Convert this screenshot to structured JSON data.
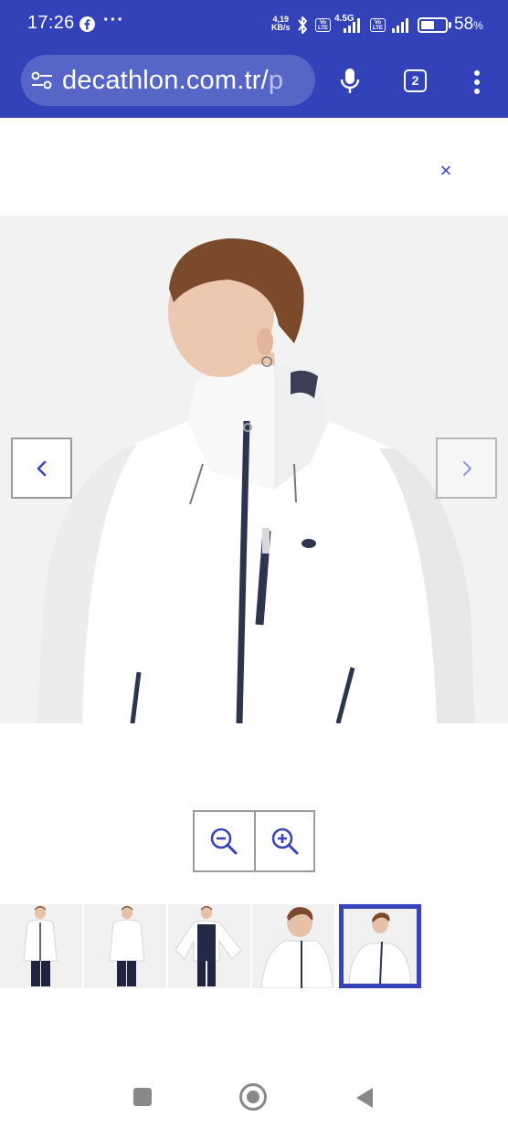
{
  "status_bar": {
    "time": "17:26",
    "notification_dots": "···",
    "net_speed_value": "4,19",
    "net_speed_unit": "KB/s",
    "volte_label": "Vo LTE",
    "network_type": "4.5G",
    "battery_percent": "58",
    "battery_unit": "%",
    "battery_level": 0.58
  },
  "browser": {
    "url_main": "decathlon.com.tr/",
    "url_trail": "p",
    "tab_count": "2"
  },
  "page": {
    "close_symbol": "×",
    "gallery": {
      "thumbnail_count": 5,
      "selected_index": 4,
      "accent_color": "#3643ba"
    }
  },
  "colors": {
    "browser_bar": "#3342b8",
    "url_pill": "#5766c6",
    "brand_blue": "#3643ba"
  },
  "icons": {
    "status": [
      "facebook-icon",
      "bluetooth-icon",
      "signal-icon",
      "battery-icon"
    ],
    "browser": [
      "site-settings-icon",
      "microphone-icon",
      "tab-switcher-icon",
      "overflow-menu-icon"
    ],
    "page": [
      "close-icon",
      "chevron-left-icon",
      "chevron-right-icon",
      "zoom-out-icon",
      "zoom-in-icon"
    ],
    "system": [
      "recents-icon",
      "home-icon",
      "back-icon"
    ]
  }
}
